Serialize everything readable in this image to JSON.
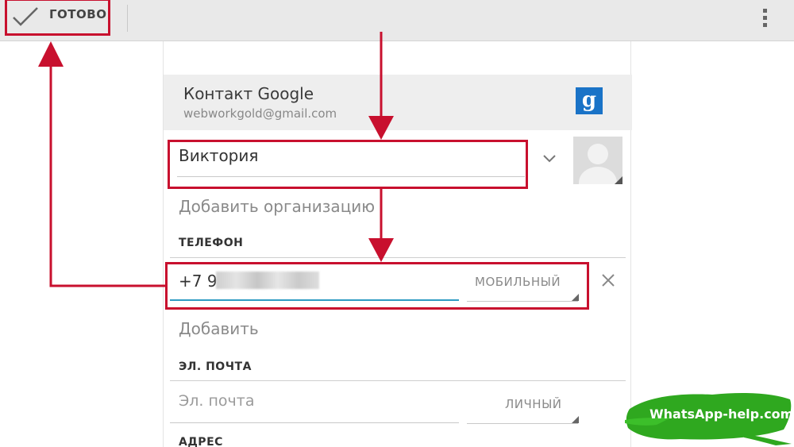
{
  "toolbar": {
    "done_label": "ГОТОВО",
    "check_icon": "check-icon",
    "overflow_icon": "more-vert-icon"
  },
  "account": {
    "title": "Контакт Google",
    "email": "webworkgold@gmail.com",
    "badge": "g"
  },
  "name": {
    "value": "Виктория"
  },
  "organization": {
    "label": "Добавить организацию"
  },
  "phone": {
    "header": "ТЕЛЕФОН",
    "value": "+7 9",
    "type": "МОБИЛЬНЫЙ",
    "add_label": "Добавить"
  },
  "email": {
    "header": "ЭЛ. ПОЧТА",
    "placeholder": "Эл. почта",
    "type": "ЛИЧНЫЙ"
  },
  "address": {
    "header": "АДРЕС"
  },
  "watermark": "WhatsApp-help.com",
  "colors": {
    "annotation_red": "#c8102e",
    "accent_blue": "#2e9bc3",
    "google_blue": "#1a73c7",
    "watermark_green": "#2fa81f"
  }
}
